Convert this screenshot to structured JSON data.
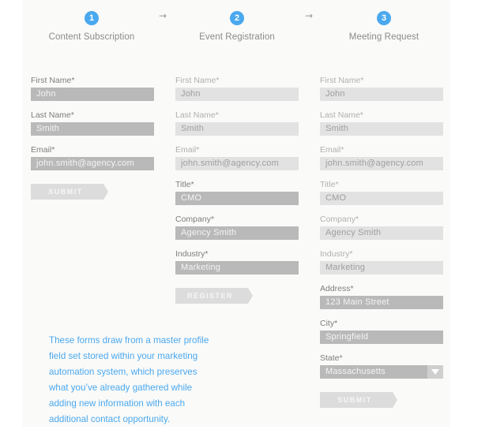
{
  "steps": [
    {
      "number": "1",
      "title": "Content Subscription"
    },
    {
      "number": "2",
      "title": "Event Registration"
    },
    {
      "number": "3",
      "title": "Meeting Request"
    }
  ],
  "arrow_glyph": "→",
  "forms": [
    {
      "fields": [
        {
          "label": "First Name*",
          "value": "John"
        },
        {
          "label": "Last Name*",
          "value": "Smith"
        },
        {
          "label": "Email*",
          "value": "john.smith@agency.com"
        }
      ],
      "button": "SUBMIT"
    },
    {
      "fields": [
        {
          "label": "First Name*",
          "value": "John"
        },
        {
          "label": "Last Name*",
          "value": "Smith"
        },
        {
          "label": "Email*",
          "value": "john.smith@agency.com"
        },
        {
          "label": "Title*",
          "value": "CMO"
        },
        {
          "label": "Company*",
          "value": "Agency Smith"
        },
        {
          "label": "Industry*",
          "value": "Marketing"
        }
      ],
      "button": "REGISTER"
    },
    {
      "fields": [
        {
          "label": "First Name*",
          "value": "John"
        },
        {
          "label": "Last Name*",
          "value": "Smith"
        },
        {
          "label": "Email*",
          "value": "john.smith@agency.com"
        },
        {
          "label": "Title*",
          "value": "CMO"
        },
        {
          "label": "Company*",
          "value": "Agency Smith"
        },
        {
          "label": "Industry*",
          "value": "Marketing"
        },
        {
          "label": "Address*",
          "value": "123 Main Street"
        },
        {
          "label": "City*",
          "value": "Springfield"
        },
        {
          "label": "State*",
          "value": "Massachusetts",
          "type": "select",
          "icon": "dropdown-triangle-icon"
        }
      ],
      "button": "SUBMIT"
    }
  ],
  "note_lines": [
    "These forms draw from a master profile",
    "field set stored within your marketing",
    "automation system, which preserves",
    "what you’ve already gathered while",
    "adding new information with each",
    "additional contact opportunity."
  ],
  "colors": {
    "accent": "#4aa8ee",
    "active_field": "#b9b9b9",
    "prefilled_field": "#e2e2e2",
    "button": "#dcdcdc"
  }
}
